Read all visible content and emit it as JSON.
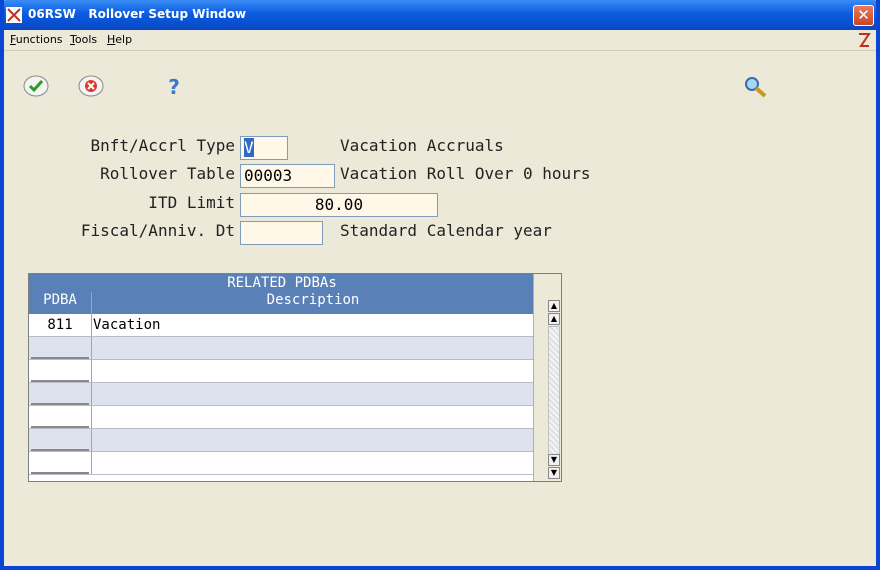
{
  "window": {
    "app_code": "06RSW",
    "title": "Rollover Setup Window"
  },
  "menu": {
    "functions": {
      "u": "F",
      "rest": "unctions"
    },
    "tools": {
      "u": "T",
      "rest": "ools"
    },
    "help": {
      "u": "H",
      "rest": "elp"
    }
  },
  "toolbar": {
    "ok_icon": "checkmark-icon",
    "cancel_icon": "x-circle-icon",
    "help_glyph": "?",
    "search_icon": "magnifier-icon"
  },
  "form": {
    "bnft_label": "Bnft/Accrl Type",
    "bnft_value": "V",
    "bnft_desc": "Vacation Accruals",
    "rollover_label": "Rollover Table",
    "rollover_value": "00003",
    "rollover_desc": "Vacation Roll Over 0 hours",
    "itd_label": "ITD Limit",
    "itd_value": "80.00",
    "fiscal_label": "Fiscal/Anniv. Dt",
    "fiscal_value": "",
    "fiscal_desc": "Standard Calendar year"
  },
  "grid": {
    "title": "RELATED PDBAs",
    "col_pdba": "PDBA",
    "col_desc": "Description",
    "rows": [
      {
        "pdba": "811",
        "desc": "Vacation"
      },
      {
        "pdba": "",
        "desc": ""
      },
      {
        "pdba": "",
        "desc": ""
      },
      {
        "pdba": "",
        "desc": ""
      },
      {
        "pdba": "",
        "desc": ""
      },
      {
        "pdba": "",
        "desc": ""
      },
      {
        "pdba": "",
        "desc": ""
      }
    ]
  },
  "colors": {
    "titlebar": "#0a5ce0",
    "grid_header": "#5a80b8",
    "field_bg": "#fff8e8"
  }
}
